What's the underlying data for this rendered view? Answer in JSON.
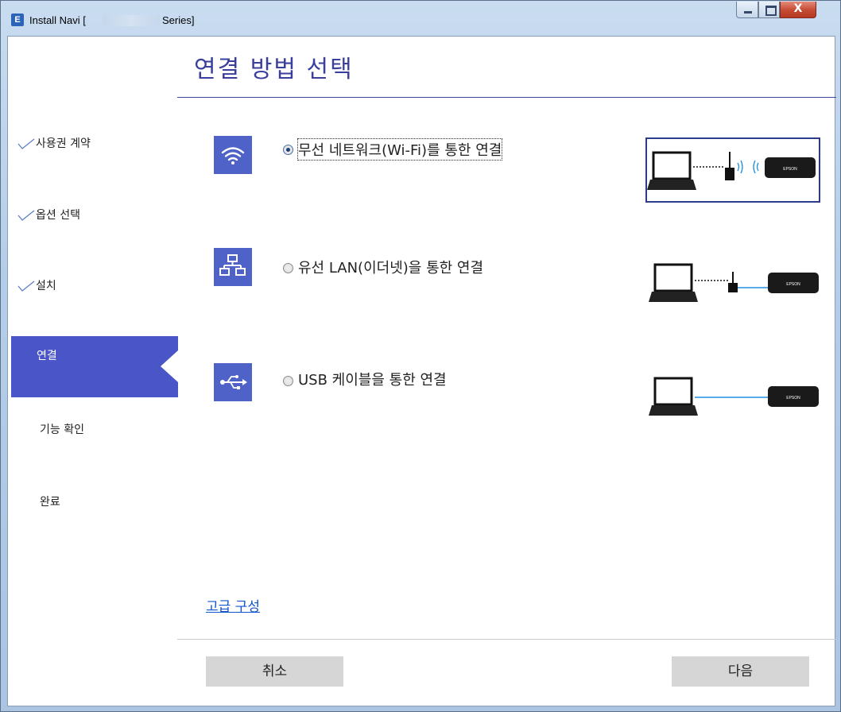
{
  "window": {
    "title_prefix": "Install Navi [",
    "title_suffix": "Series]",
    "app_icon": "E",
    "close_glyph": "X"
  },
  "page_title": "연결 방법 선택",
  "sidebar": {
    "items": [
      {
        "label": "사용권 계약",
        "state": "done"
      },
      {
        "label": "옵션 선택",
        "state": "done"
      },
      {
        "label": "설치",
        "state": "done"
      },
      {
        "label": "연결",
        "state": "active"
      },
      {
        "label": "기능 확인",
        "state": "pending"
      },
      {
        "label": "완료",
        "state": "pending"
      }
    ]
  },
  "options": [
    {
      "label": "무선 네트워크(Wi-Fi)를 통한 연결",
      "selected": true,
      "icon": "wifi-icon"
    },
    {
      "label": "유선 LAN(이더넷)을 통한 연결",
      "selected": false,
      "icon": "network-icon"
    },
    {
      "label": "USB 케이블을 통한 연결",
      "selected": false,
      "icon": "usb-icon"
    }
  ],
  "printer_brand": "EPSON",
  "advanced_link": "고급 구성",
  "buttons": {
    "cancel": "취소",
    "next": "다음"
  },
  "colors": {
    "accent": "#4a56c7",
    "icon_bg": "#4f62c8",
    "title": "#3b3f9c",
    "link": "#1155cc",
    "cable": "#1e8fe0"
  }
}
